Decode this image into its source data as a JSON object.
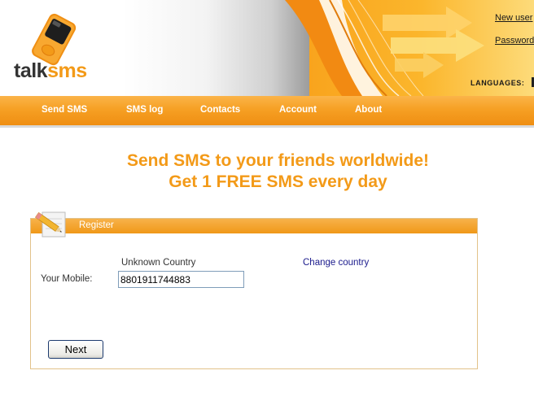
{
  "brand": {
    "talk": "talk",
    "sms": "sms",
    "accent": "#f39a18"
  },
  "top_links": {
    "new_user": "New user",
    "password": "Password"
  },
  "languages_label": "LANGUAGES:",
  "nav": {
    "items": [
      {
        "label": "Send SMS"
      },
      {
        "label": "SMS log"
      },
      {
        "label": "Contacts"
      },
      {
        "label": "Account"
      },
      {
        "label": "About"
      }
    ]
  },
  "headline": {
    "line1": "Send SMS to your friends worldwide!",
    "line2": "Get 1 FREE SMS every day"
  },
  "register": {
    "title": "Register",
    "country": "Unknown Country",
    "change_country": "Change country",
    "mobile_label": "Your Mobile:",
    "mobile_value": "8801911744883",
    "next_label": "Next"
  },
  "icons": [
    "phone-logo-icon",
    "pencil-notepad-icon",
    "arrow-decoration-icon",
    "language-flag-icon"
  ]
}
